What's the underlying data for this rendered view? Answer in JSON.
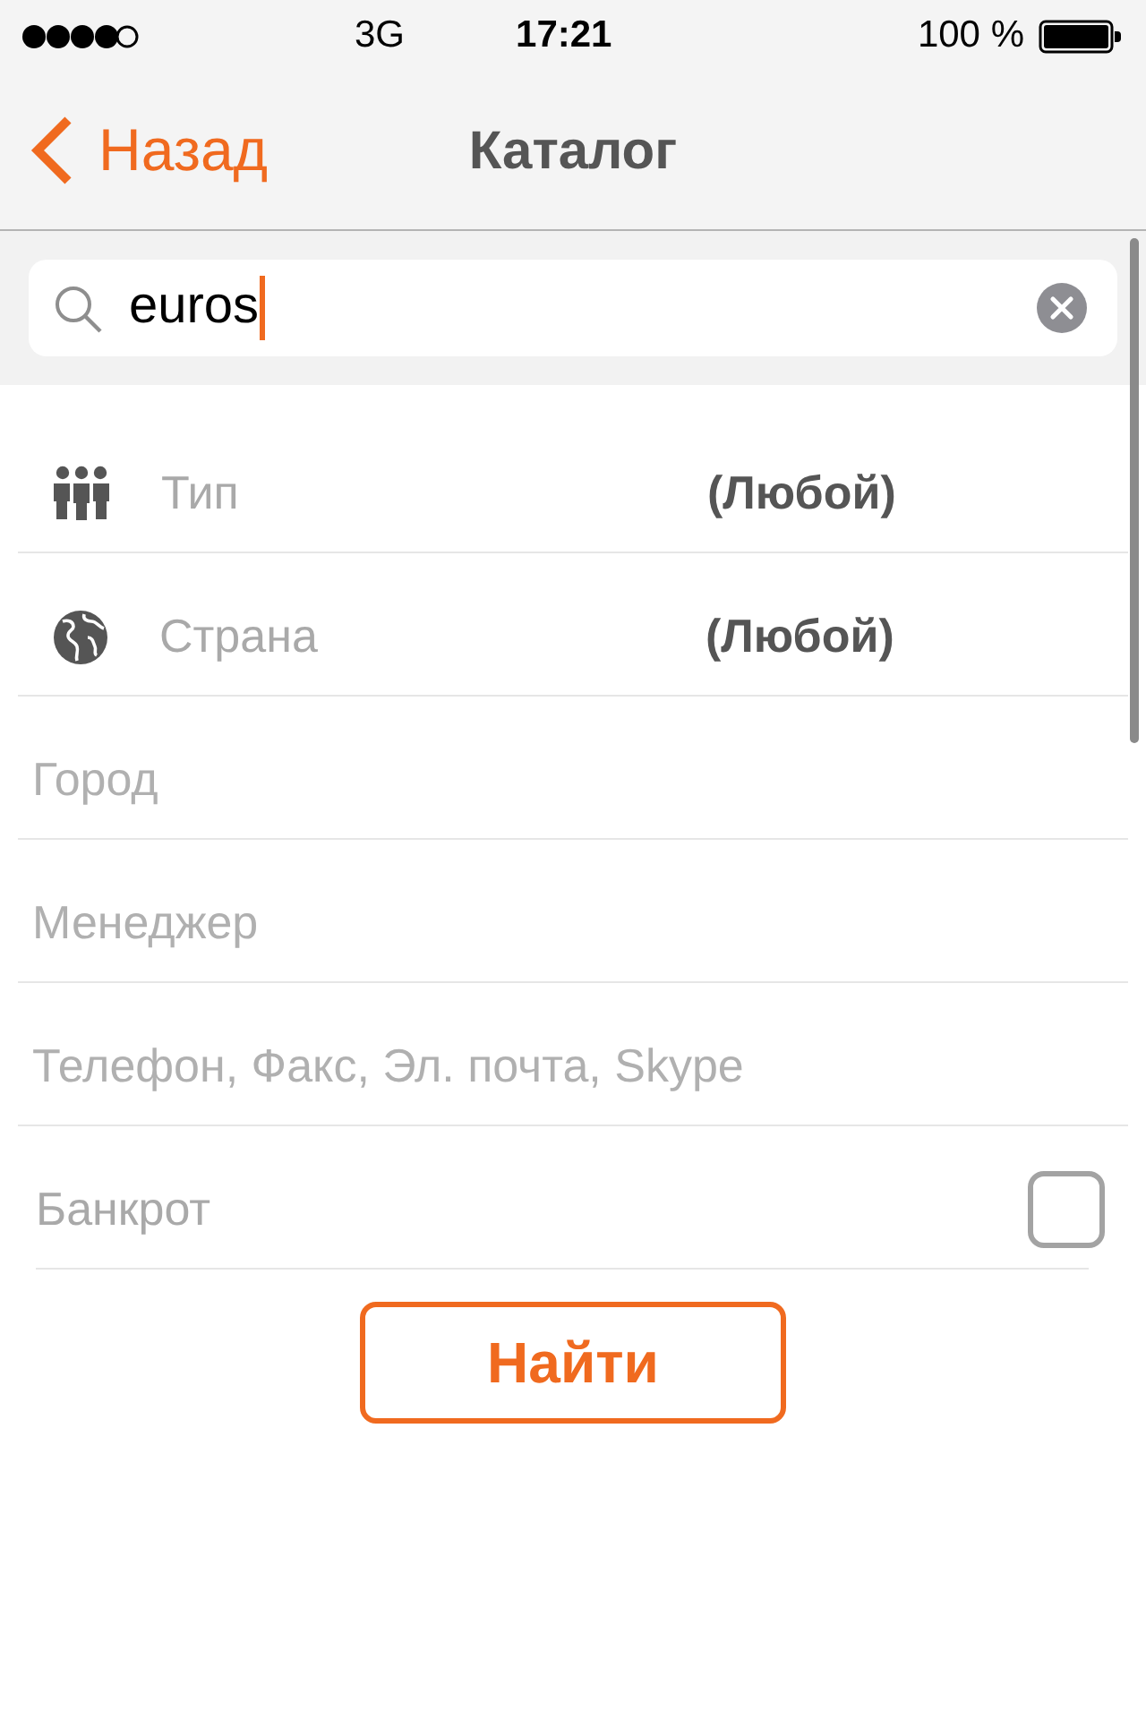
{
  "status_bar": {
    "network": "3G",
    "time": "17:21",
    "battery": "100 %"
  },
  "nav": {
    "back": "Назад",
    "title": "Каталог"
  },
  "search": {
    "value": "euros",
    "focused": true
  },
  "type_picker": {
    "label": "Тип",
    "value": "(Любой)"
  },
  "country_picker": {
    "label": "Страна",
    "value": "(Любой)"
  },
  "fields": [
    {
      "placeholder": "Город"
    },
    {
      "placeholder": "Менеджер"
    },
    {
      "placeholder": "Телефон, Факс, Эл. почта, Skype"
    }
  ],
  "bankrupt": {
    "label": "Банкрот",
    "checked": false
  },
  "search_button": "Найти"
}
